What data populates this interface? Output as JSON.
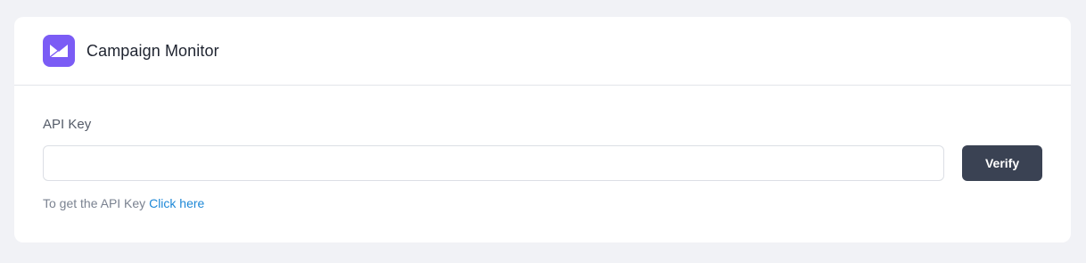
{
  "integration": {
    "title": "Campaign Monitor",
    "logo_icon": "envelope-icon",
    "logo_color": "#7b5cf5"
  },
  "form": {
    "api_key_label": "API Key",
    "api_key_value": "",
    "api_key_placeholder": "",
    "verify_label": "Verify",
    "help_text": "To get the API Key",
    "help_link_label": "Click here"
  },
  "colors": {
    "button_bg": "#3a4253",
    "link": "#1e88d7",
    "page_bg": "#f1f2f6"
  }
}
